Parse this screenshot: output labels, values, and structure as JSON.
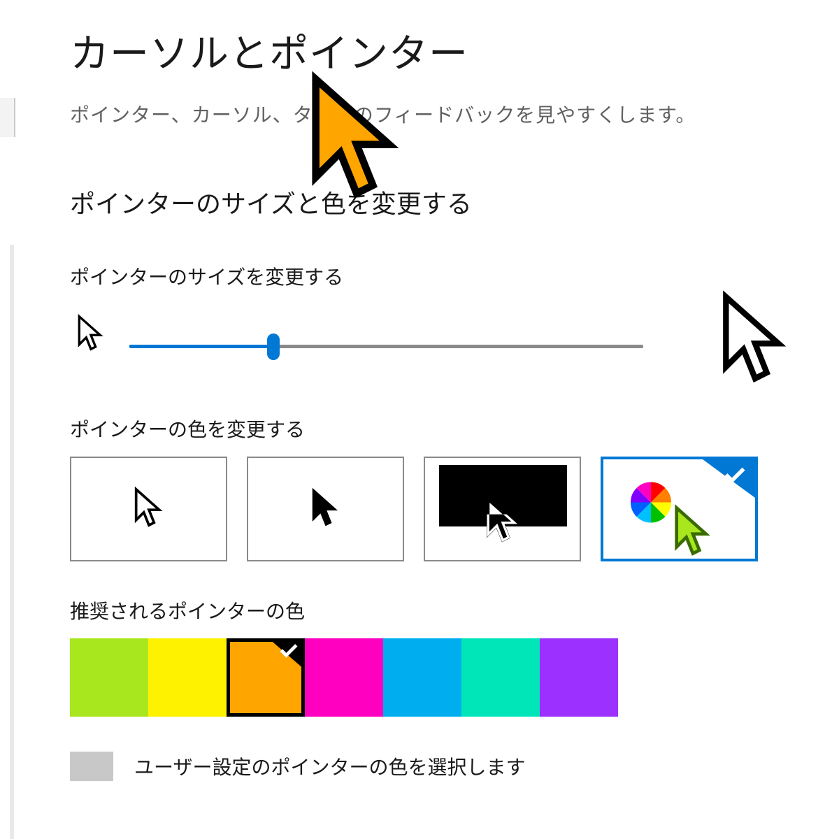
{
  "page": {
    "title": "カーソルとポインター",
    "subtitle": "ポインター、カーソル、タッチのフィードバックを見やすくします。"
  },
  "section": {
    "heading": "ポインターのサイズと色を変更する"
  },
  "size": {
    "label": "ポインターのサイズを変更する",
    "value_percent": 28
  },
  "color_mode": {
    "label": "ポインターの色を変更する",
    "options": [
      "white",
      "black",
      "inverted",
      "custom"
    ],
    "selected_index": 3
  },
  "recommended": {
    "label": "推奨されるポインターの色",
    "colors": [
      "#A8E61D",
      "#FFF200",
      "#FFA500",
      "#FF00C0",
      "#00AEEF",
      "#00E6B8",
      "#9B30FF"
    ],
    "selected_index": 2
  },
  "custom": {
    "label": "ユーザー設定のポインターの色を選択します"
  },
  "live_cursor_color": "#FFA500"
}
